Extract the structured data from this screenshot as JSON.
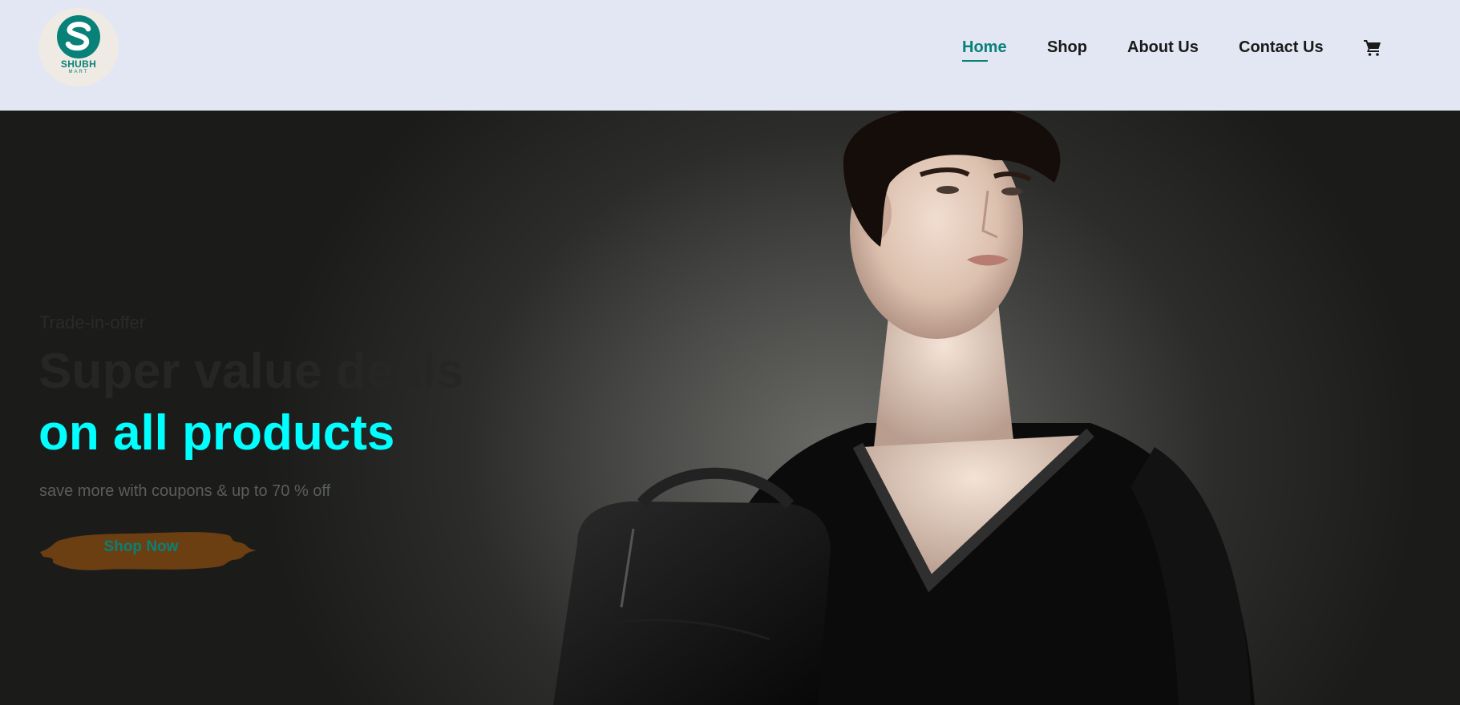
{
  "header": {
    "logo": {
      "icon": "shubh-mart-logo",
      "word": "SHUBH",
      "sub": "MART"
    },
    "nav": [
      {
        "label": "Home",
        "active": true
      },
      {
        "label": "Shop",
        "active": false
      },
      {
        "label": "About Us",
        "active": false
      },
      {
        "label": "Contact Us",
        "active": false
      }
    ],
    "cart_icon": "cart-icon"
  },
  "hero": {
    "offer": "Trade-in-offer",
    "headline_line1": "Super value deals",
    "headline_line2": "on all products",
    "subtext": "save more with coupons & up to 70 % off",
    "button_label": "Shop Now"
  },
  "colors": {
    "accent": "#088178",
    "header_bg": "#e3e6f3",
    "headline_highlight": "#00ffff",
    "button_brush": "#6b3f12"
  }
}
